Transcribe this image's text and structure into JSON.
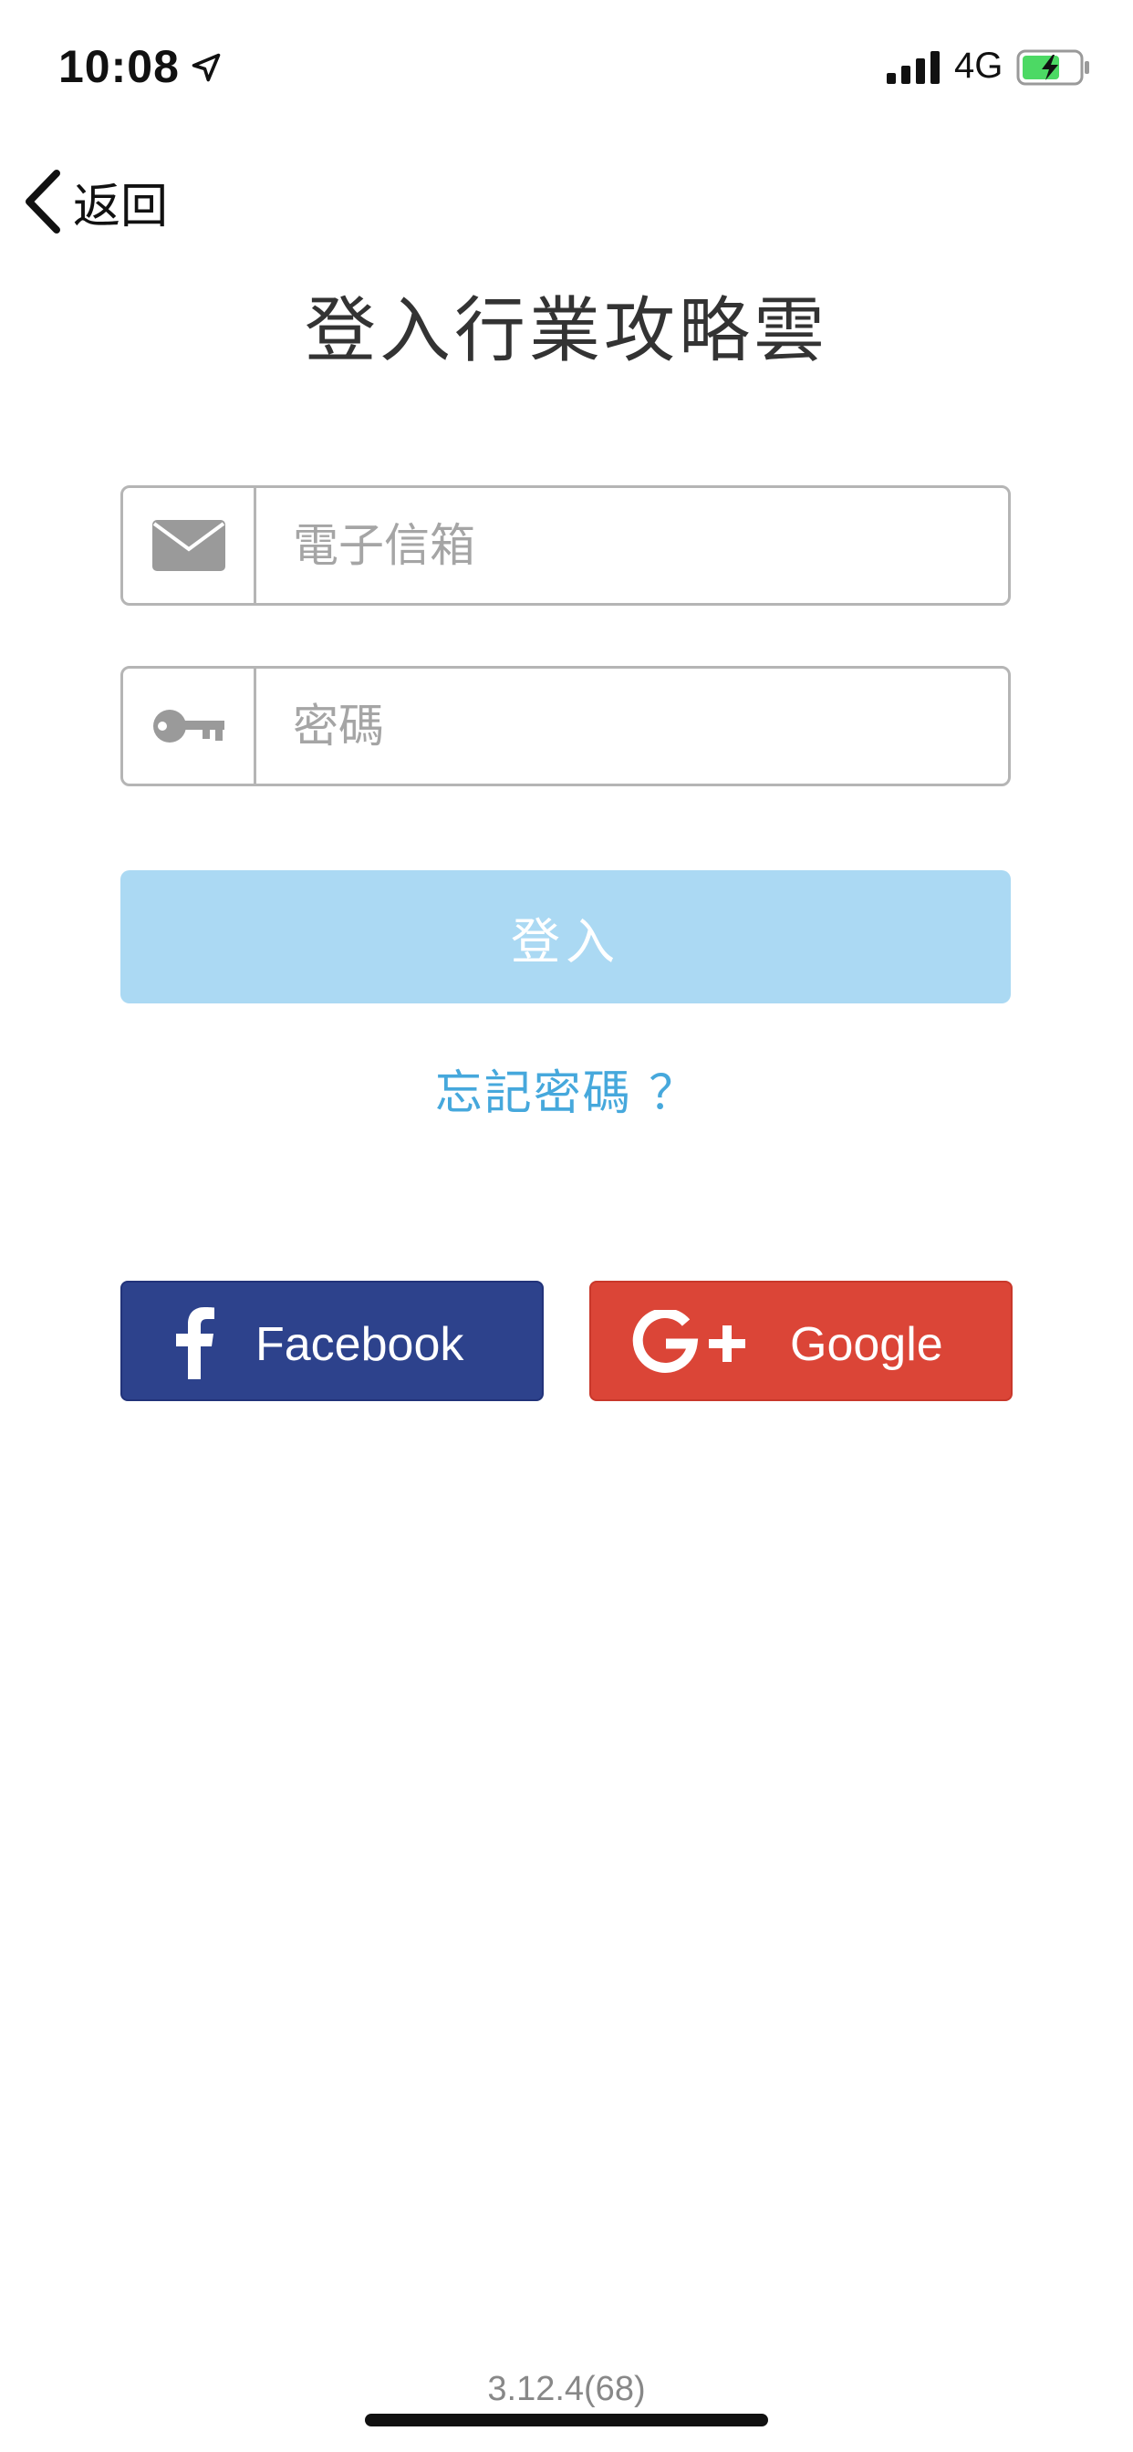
{
  "status_bar": {
    "time": "10:08",
    "network": "4G",
    "location_icon": "location-arrow-icon",
    "signal_icon": "signal-bars-icon",
    "battery_icon": "battery-charging-icon",
    "battery_color": "#4cd964"
  },
  "nav": {
    "back_label": "返回",
    "back_icon": "chevron-left-icon"
  },
  "title": "登入行業攻略雲",
  "form": {
    "email_placeholder": "電子信箱",
    "email_value": "",
    "email_icon": "envelope-icon",
    "password_placeholder": "密碼",
    "password_value": "",
    "password_icon": "key-icon",
    "login_label": "登入",
    "login_color": "#abd9f3",
    "forgot_label": "忘記密碼 ？",
    "forgot_color": "#46a8dc"
  },
  "social": {
    "facebook_label": "Facebook",
    "facebook_color": "#2d428c",
    "facebook_icon": "facebook-f-icon",
    "google_label": "Google",
    "google_color": "#db4537",
    "google_icon": "google-plus-icon"
  },
  "footer": {
    "version": "3.12.4(68)"
  }
}
